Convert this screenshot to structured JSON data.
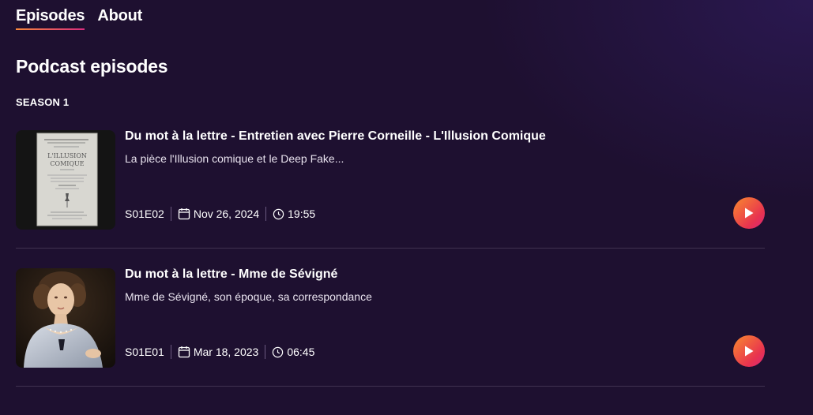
{
  "tabs": [
    {
      "label": "Episodes",
      "active": true
    },
    {
      "label": "About",
      "active": false
    }
  ],
  "page_title": "Podcast episodes",
  "season_label": "SEASON 1",
  "episodes": [
    {
      "title": "Du mot à la lettre - Entretien avec Pierre Corneille - L'Illusion Comique",
      "description": "La pièce l'Illusion comique et le Deep Fake...",
      "code": "S01E02",
      "date": "Nov 26, 2024",
      "duration": "19:55",
      "thumbnail": "book-cover-illusion-comique",
      "thumbnail_text": [
        "L'ILLUSION",
        "COMIQUE"
      ]
    },
    {
      "title": "Du mot à la lettre - Mme de Sévigné",
      "description": "Mme de Sévigné, son époque, sa correspondance",
      "code": "S01E01",
      "date": "Mar 18, 2023",
      "duration": "06:45",
      "thumbnail": "portrait-mme-de-sevigne"
    }
  ],
  "colors": {
    "background": "#1e1030",
    "accent_start": "#f98a2e",
    "accent_end": "#d8267a",
    "divider": "#3f3150"
  },
  "icons": [
    "calendar-icon",
    "clock-icon",
    "play-icon"
  ]
}
